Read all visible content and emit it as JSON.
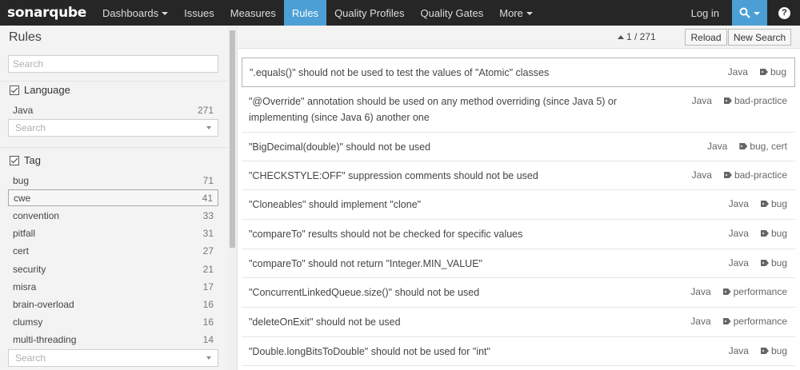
{
  "nav": {
    "logo_prefix": "sonar",
    "logo_suffix": "qube",
    "items": [
      {
        "label": "Dashboards",
        "dropdown": true
      },
      {
        "label": "Issues"
      },
      {
        "label": "Measures"
      },
      {
        "label": "Rules",
        "active": true
      },
      {
        "label": "Quality Profiles"
      },
      {
        "label": "Quality Gates"
      },
      {
        "label": "More",
        "dropdown": true
      }
    ],
    "login": "Log in",
    "help": "?"
  },
  "sidebar": {
    "title": "Rules",
    "search_placeholder": "Search",
    "language": {
      "heading": "Language",
      "items": [
        {
          "label": "Java",
          "count": "271"
        }
      ],
      "select_placeholder": "Search"
    },
    "tag": {
      "heading": "Tag",
      "items": [
        {
          "label": "bug",
          "count": "71"
        },
        {
          "label": "cwe",
          "count": "41"
        },
        {
          "label": "convention",
          "count": "33"
        },
        {
          "label": "pitfall",
          "count": "31"
        },
        {
          "label": "cert",
          "count": "27"
        },
        {
          "label": "security",
          "count": "21"
        },
        {
          "label": "misra",
          "count": "17"
        },
        {
          "label": "brain-overload",
          "count": "16"
        },
        {
          "label": "clumsy",
          "count": "16"
        },
        {
          "label": "multi-threading",
          "count": "14"
        }
      ],
      "select_placeholder": "Search"
    }
  },
  "toolbar": {
    "pager": "1 / 271",
    "reload": "Reload",
    "new_search": "New Search"
  },
  "rules": [
    {
      "title": "\".equals()\" should not be used to test the values of \"Atomic\" classes",
      "lang": "Java",
      "tags": "bug"
    },
    {
      "title": "\"@Override\" annotation should be used on any method overriding (since Java 5) or",
      "title2": "implementing (since Java 6) another one",
      "lang": "Java",
      "tags": "bad-practice"
    },
    {
      "title": "\"BigDecimal(double)\" should not be used",
      "lang": "Java",
      "tags": "bug, cert"
    },
    {
      "title": "\"CHECKSTYLE:OFF\" suppression comments should not be used",
      "lang": "Java",
      "tags": "bad-practice"
    },
    {
      "title": "\"Cloneables\" should implement \"clone\"",
      "lang": "Java",
      "tags": "bug"
    },
    {
      "title": "\"compareTo\" results should not be checked for specific values",
      "lang": "Java",
      "tags": "bug"
    },
    {
      "title": "\"compareTo\" should not return \"Integer.MIN_VALUE\"",
      "lang": "Java",
      "tags": "bug"
    },
    {
      "title": "\"ConcurrentLinkedQueue.size()\" should not be used",
      "lang": "Java",
      "tags": "performance"
    },
    {
      "title": "\"deleteOnExit\" should not be used",
      "lang": "Java",
      "tags": "performance"
    },
    {
      "title": "\"Double.longBitsToDouble\" should not be used for \"int\"",
      "lang": "Java",
      "tags": "bug"
    }
  ]
}
